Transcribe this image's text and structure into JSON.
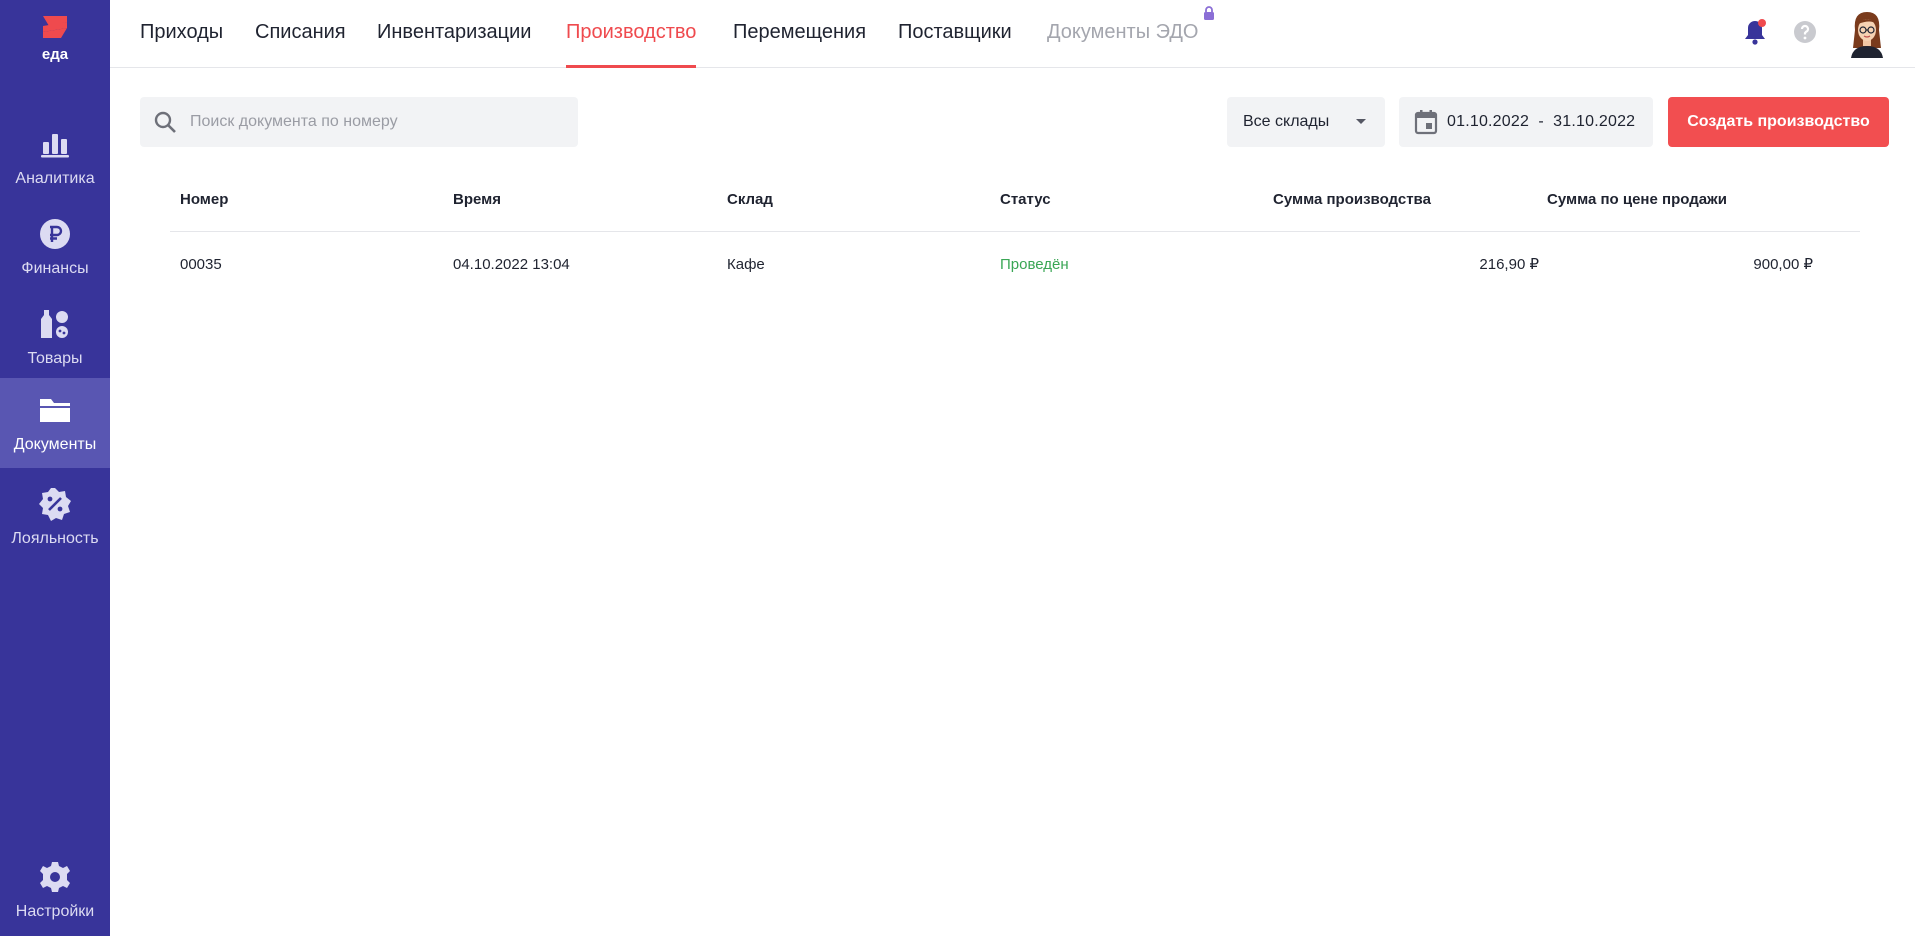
{
  "sidebar": {
    "logo_text": "еда",
    "items": [
      {
        "label": "Аналитика",
        "icon": "bar-chart-icon"
      },
      {
        "label": "Финансы",
        "icon": "ruble-icon"
      },
      {
        "label": "Товары",
        "icon": "products-icon"
      },
      {
        "label": "Документы",
        "icon": "folder-icon",
        "active": true
      },
      {
        "label": "Лояльность",
        "icon": "discount-badge-icon"
      }
    ],
    "settings_label": "Настройки"
  },
  "tabs": [
    {
      "label": "Приходы"
    },
    {
      "label": "Списания"
    },
    {
      "label": "Инвентаризации"
    },
    {
      "label": "Производство",
      "active": true
    },
    {
      "label": "Перемещения"
    },
    {
      "label": "Поставщики"
    },
    {
      "label": "Документы ЭДО",
      "locked": true
    }
  ],
  "header": {
    "notification_icon": "bell-icon",
    "help_icon": "question-icon",
    "avatar_icon": "user-avatar-icon"
  },
  "toolbar": {
    "search_placeholder": "Поиск документа по номеру",
    "warehouse_label": "Все склады",
    "date_range": "01.10.2022  -  31.10.2022",
    "create_label": "Создать производство"
  },
  "table": {
    "columns": [
      "Номер",
      "Время",
      "Склад",
      "Статус",
      "Сумма производства",
      "Сумма по цене продажи"
    ],
    "rows": [
      {
        "number": "00035",
        "time": "04.10.2022 13:04",
        "warehouse": "Кафе",
        "status": "Проведён",
        "production_sum": "216,90 ₽",
        "sale_sum": "900,00 ₽"
      }
    ]
  },
  "colors": {
    "sidebar_bg": "#38349a",
    "sidebar_active": "#5956b2",
    "accent": "#ef4a4e",
    "status_ok": "#3aa655"
  }
}
